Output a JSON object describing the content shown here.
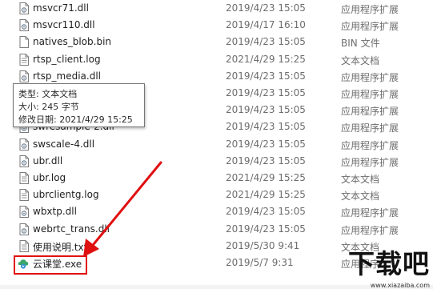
{
  "files": [
    {
      "name": "msvcr71.dll",
      "date": "2019/4/23 15:05",
      "type": "应用程序扩展",
      "icon": "dll-icon"
    },
    {
      "name": "msvcr110.dll",
      "date": "2019/4/17 16:10",
      "type": "应用程序扩展",
      "icon": "dll-icon"
    },
    {
      "name": "natives_blob.bin",
      "date": "2019/4/23 15:05",
      "type": "BIN 文件",
      "icon": "file-icon"
    },
    {
      "name": "rtsp_client.log",
      "date": "2021/4/29 15:25",
      "type": "文本文档",
      "icon": "text-file-icon"
    },
    {
      "name": "rtsp_media.dll",
      "date": "2019/4/23 15:05",
      "type": "应用程序扩展",
      "icon": "dll-icon"
    },
    {
      "name": "",
      "date": "2019/4/23 15:05",
      "type": "应用程序扩展",
      "icon": "dll-icon"
    },
    {
      "name": "",
      "date": "2019/4/23 15:05",
      "type": "应用程序扩展",
      "icon": "dll-icon"
    },
    {
      "name": "swresample-2.dll",
      "date": "2019/4/23 15:05",
      "type": "应用程序扩展",
      "icon": "dll-icon"
    },
    {
      "name": "swscale-4.dll",
      "date": "2019/4/23 15:05",
      "type": "应用程序扩展",
      "icon": "dll-icon"
    },
    {
      "name": "ubr.dll",
      "date": "2019/4/23 15:05",
      "type": "应用程序扩展",
      "icon": "dll-icon"
    },
    {
      "name": "ubr.log",
      "date": "2021/4/29 15:25",
      "type": "文本文档",
      "icon": "text-file-icon"
    },
    {
      "name": "ubrclientg.log",
      "date": "2021/4/29 15:25",
      "type": "文本文档",
      "icon": "text-file-icon"
    },
    {
      "name": "wbxtp.dll",
      "date": "2019/4/23 15:05",
      "type": "应用程序扩展",
      "icon": "dll-icon"
    },
    {
      "name": "webrtc_trans.dll",
      "date": "2019/4/23 15:05",
      "type": "应用程序扩展",
      "icon": "dll-icon"
    },
    {
      "name": "使用说明.txt",
      "date": "2019/5/30 9:41",
      "type": "文本文档",
      "icon": "text-file-icon"
    },
    {
      "name": "云课堂.exe",
      "date": "2019/5/7 9:31",
      "type": "应用程序",
      "icon": "app-icon"
    }
  ],
  "tooltip": {
    "type_line": "类型: 文本文档",
    "size_line": "大小: 245 字节",
    "modified_line": "修改日期: 2021/4/29 15:25"
  },
  "watermark": {
    "title": "下载吧",
    "url": "www.xiazaiba.com"
  },
  "colors": {
    "annotation": "#e01010",
    "text": "#1e1e1e",
    "muted": "#6d6d6d"
  }
}
